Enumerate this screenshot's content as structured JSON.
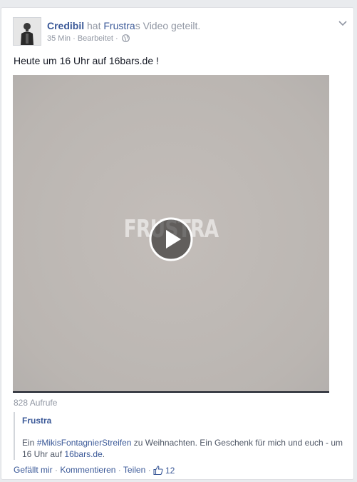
{
  "post": {
    "author": "Credibil",
    "action_pre": "hat",
    "shared_page": "Frustra",
    "action_post": "s Video geteilt.",
    "time": "35 Min",
    "meta_sep": "·",
    "edited": "Bearbeitet",
    "meta_sep2": "·",
    "text": "Heute um 16 Uhr auf 16bars.de !"
  },
  "video": {
    "watermark": "FRUSTRA",
    "views": "828 Aufrufe"
  },
  "shared": {
    "title": "Frustra",
    "desc_pre": "Ein",
    "hashtag": "#MikisFontagnierStreifen",
    "desc_mid": "zu Weihnachten. Ein Geschenk für mich und euch - um 16 Uhr auf",
    "link": "16bars.de",
    "desc_end": "."
  },
  "actions": {
    "like": "Gefällt mir",
    "sep1": "·",
    "comment": "Kommentieren",
    "sep2": "·",
    "share": "Teilen",
    "sep3": "·",
    "like_count": "12"
  },
  "icons": {
    "globe": "globe-icon",
    "chevron": "chevron-down-icon",
    "play": "play-icon",
    "thumb": "thumbs-up-icon"
  },
  "colors": {
    "link": "#3b5998",
    "meta": "#9197a3",
    "text": "#141823"
  }
}
